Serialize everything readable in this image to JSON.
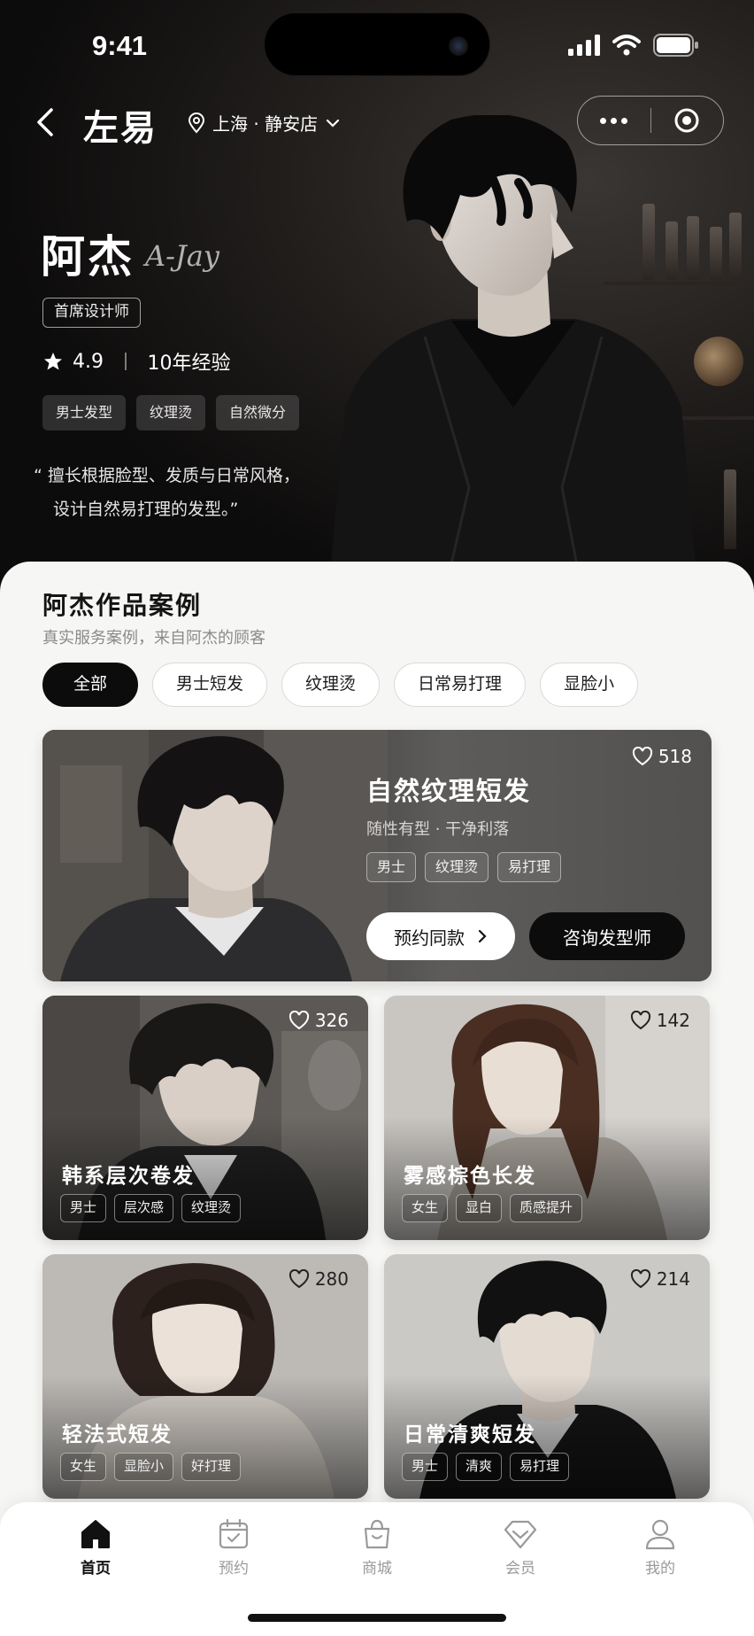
{
  "status_bar": {
    "time": "9:41"
  },
  "nav": {
    "brand": "左易",
    "location": "上海 · 静安店"
  },
  "stylist": {
    "name": "阿杰",
    "name_en": "A-Jay",
    "title": "首席设计师",
    "rating": "4.9",
    "experience": "10年经验",
    "skills": [
      "男士发型",
      "纹理烫",
      "自然微分"
    ],
    "quote_line1": "“ 擅长根据脸型、发质与日常风格，",
    "quote_line2": "设计自然易打理的发型。”"
  },
  "works": {
    "title": "阿杰作品案例",
    "subtitle": "真实服务案例，来自阿杰的顾客",
    "filters": [
      "全部",
      "男士短发",
      "纹理烫",
      "日常易打理",
      "显脸小"
    ],
    "active_filter": "全部",
    "featured": {
      "title": "自然纹理短发",
      "subtitle": "随性有型 · 干净利落",
      "tags": [
        "男士",
        "纹理烫",
        "易打理"
      ],
      "likes": "518",
      "book_label": "预约同款",
      "consult_label": "咨询发型师"
    },
    "cards": [
      {
        "title": "韩系层次卷发",
        "likes": "326",
        "tags": [
          "男士",
          "层次感",
          "纹理烫"
        ]
      },
      {
        "title": "雾感棕色长发",
        "likes": "142",
        "tags": [
          "女生",
          "显白",
          "质感提升"
        ]
      },
      {
        "title": "轻法式短发",
        "likes": "280",
        "tags": [
          "女生",
          "显脸小",
          "好打理"
        ]
      },
      {
        "title": "日常清爽短发",
        "likes": "214",
        "tags": [
          "男士",
          "清爽",
          "易打理"
        ]
      }
    ]
  },
  "tabbar": {
    "items": [
      {
        "label": "首页",
        "icon": "home-icon",
        "active": true
      },
      {
        "label": "预约",
        "icon": "calendar-icon"
      },
      {
        "label": "商城",
        "icon": "shopping-bag-icon"
      },
      {
        "label": "会员",
        "icon": "diamond-icon"
      },
      {
        "label": "我的",
        "icon": "user-icon"
      }
    ]
  },
  "colors": {
    "primary": "#0c0c0c",
    "background": "#f6f6f4",
    "muted": "#9a9a9a"
  }
}
